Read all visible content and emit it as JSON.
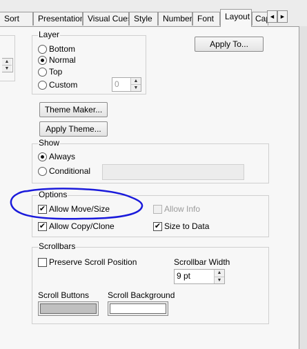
{
  "tabs": [
    {
      "label": "Sort",
      "active": false
    },
    {
      "label": "Presentation",
      "active": false
    },
    {
      "label": "Visual Cues",
      "active": false
    },
    {
      "label": "Style",
      "active": false
    },
    {
      "label": "Number",
      "active": false
    },
    {
      "label": "Font",
      "active": false
    },
    {
      "label": "Layout",
      "active": true
    },
    {
      "label": "Cap",
      "active": false
    }
  ],
  "tab_scroll": {
    "left": "◄",
    "right": "►"
  },
  "layer": {
    "legend": "Layer",
    "options": [
      {
        "label": "Bottom",
        "selected": false
      },
      {
        "label": "Normal",
        "selected": true
      },
      {
        "label": "Top",
        "selected": false
      },
      {
        "label": "Custom",
        "selected": false
      }
    ],
    "custom_value": "0"
  },
  "apply_to_label": "Apply To...",
  "theme_maker_label": "Theme Maker...",
  "apply_theme_label": "Apply Theme...",
  "show": {
    "legend": "Show",
    "options": [
      {
        "label": "Always",
        "selected": true
      },
      {
        "label": "Conditional",
        "selected": false
      }
    ]
  },
  "options": {
    "legend": "Options",
    "allow_move_size": {
      "label": "Allow Move/Size",
      "checked": true
    },
    "allow_info": {
      "label": "Allow Info",
      "checked": false,
      "enabled": false
    },
    "allow_copy_clone": {
      "label": "Allow Copy/Clone",
      "checked": true
    },
    "size_to_data": {
      "label": "Size to Data",
      "checked": true
    }
  },
  "scrollbars": {
    "legend": "Scrollbars",
    "preserve_scroll": {
      "label": "Preserve Scroll Position",
      "checked": false
    },
    "width_label": "Scrollbar Width",
    "width_value": "9 pt",
    "buttons_label": "Scroll Buttons",
    "background_label": "Scroll Background",
    "button_color": "#c0c0c0",
    "background_color": "#ffffff"
  },
  "check_mark": "✔",
  "spin_up": "▲",
  "spin_down": "▼",
  "annotation_color": "#1a1adb"
}
